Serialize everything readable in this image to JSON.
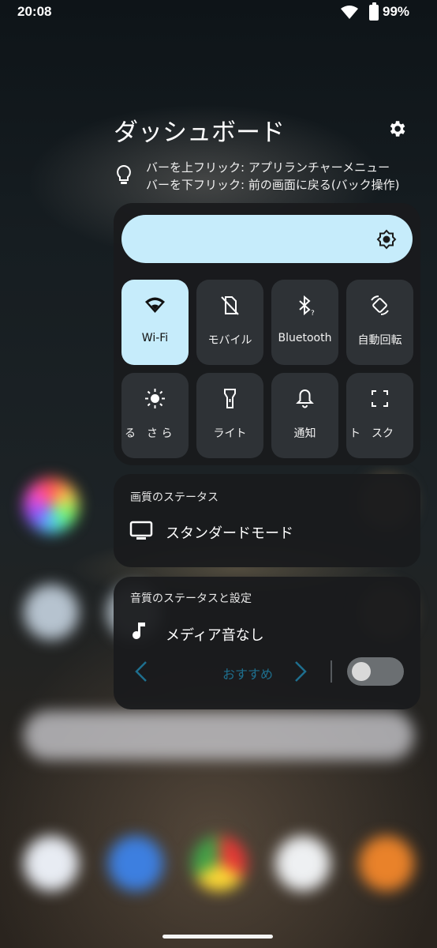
{
  "status_bar": {
    "time": "20:08",
    "battery_percent": "99%"
  },
  "panel": {
    "title": "ダッシュボード",
    "hint_lines": [
      "バーを上フリック: アプリランチャーメニュー",
      "バーを下フリック: 前の画面に戻る(バック操作)"
    ]
  },
  "quick_settings": {
    "brightness_level": 1.0,
    "accent_color": "#c6ecfb",
    "tiles": [
      {
        "label": "Wi-Fi",
        "icon": "wifi-icon",
        "active": true
      },
      {
        "label": "モバイル",
        "icon": "mobile-data-off-icon",
        "active": false
      },
      {
        "label": "Bluetooth",
        "icon": "bluetooth-icon",
        "active": false
      },
      {
        "label": "自動回転",
        "icon": "auto-rotate-icon",
        "active": false
      },
      {
        "label": "る　さ ら",
        "icon": "brightness-icon",
        "active": false
      },
      {
        "label": "ライト",
        "icon": "flashlight-icon",
        "active": false
      },
      {
        "label": "通知",
        "icon": "bell-icon",
        "active": false
      },
      {
        "label": "ト　スク",
        "icon": "screenshot-icon",
        "active": false
      }
    ]
  },
  "picture_quality": {
    "heading": "画質のステータス",
    "mode": "スタンダードモード"
  },
  "sound": {
    "heading": "音質のステータスと設定",
    "status": "メディア音なし",
    "recommend_label": "おすすめ",
    "toggle_on": false
  }
}
